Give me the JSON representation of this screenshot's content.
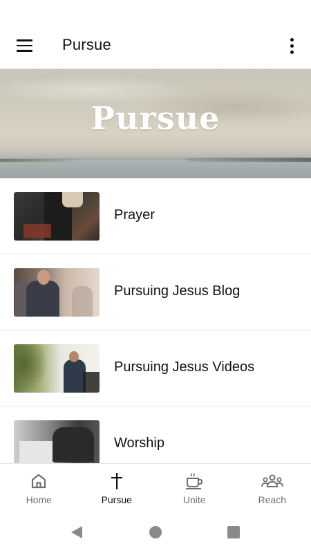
{
  "app_bar": {
    "title": "Pursue",
    "menu_icon": "hamburger-menu-icon",
    "overflow_icon": "more-vert-icon"
  },
  "hero": {
    "title": "Pursue"
  },
  "list": {
    "items": [
      {
        "label": "Prayer",
        "thumbnail": "people-praying-photo"
      },
      {
        "label": "Pursuing Jesus Blog",
        "thumbnail": "people-greeting-photo"
      },
      {
        "label": "Pursuing Jesus Videos",
        "thumbnail": "man-with-backpack-photo"
      },
      {
        "label": "Worship",
        "thumbnail": "hands-raised-worship-photo"
      }
    ]
  },
  "bottom_nav": {
    "items": [
      {
        "label": "Home",
        "icon": "home-icon",
        "active": false
      },
      {
        "label": "Pursue",
        "icon": "cross-icon",
        "active": true
      },
      {
        "label": "Unite",
        "icon": "coffee-cup-icon",
        "active": false
      },
      {
        "label": "Reach",
        "icon": "group-icon",
        "active": false
      }
    ]
  },
  "system_nav": {
    "back_icon": "back-triangle-icon",
    "home_icon": "home-circle-icon",
    "recents_icon": "recents-square-icon"
  },
  "colors": {
    "text_primary": "#111111",
    "text_secondary": "#6f6f6f",
    "divider": "#e6e6e6",
    "system_nav_icon": "#8a8a8a"
  }
}
